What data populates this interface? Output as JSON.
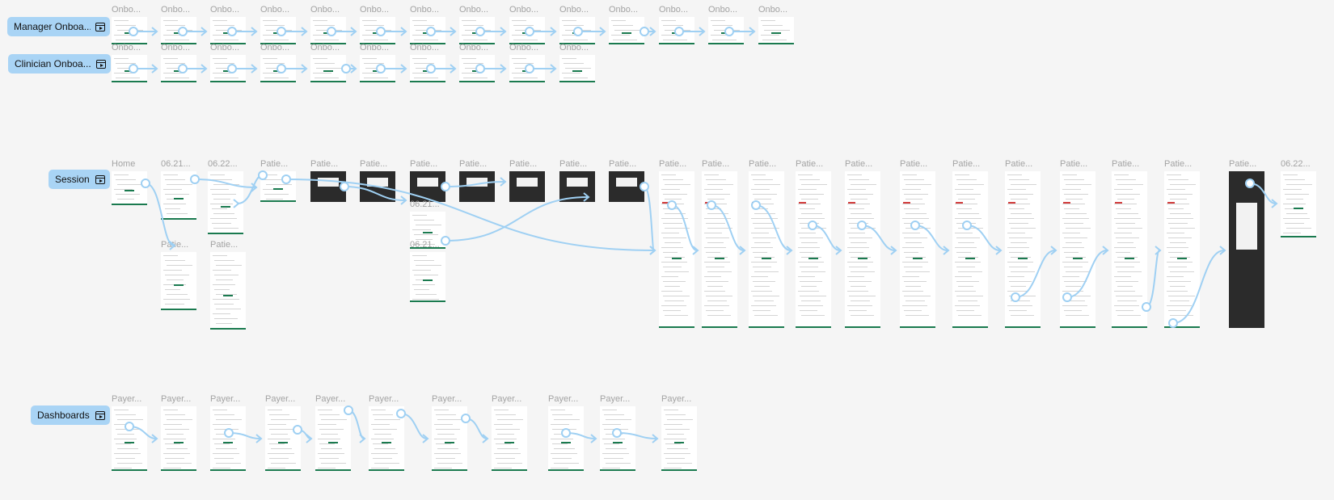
{
  "colors": {
    "canvas": "#f5f5f5",
    "pill": "#a9d4f5",
    "connector": "#9fd0f3",
    "accent": "#1a7a4f",
    "alert": "#d23c3c",
    "frame_title": "#a3a3a3"
  },
  "flows": [
    {
      "id": "manager",
      "label": "Manager Onboa...",
      "icon": "play-frame-icon"
    },
    {
      "id": "clinician",
      "label": "Clinician Onboa...",
      "icon": "play-frame-icon"
    },
    {
      "id": "session",
      "label": "Session",
      "icon": "play-frame-icon"
    },
    {
      "id": "dashboards",
      "label": "Dashboards",
      "icon": "play-frame-icon"
    }
  ],
  "frame_titles": {
    "onbo": "Onbo...",
    "home": "Home",
    "d0621": "06.21...",
    "d0622": "06.22...",
    "patie": "Patie...",
    "payer": "Payer..."
  },
  "frames": [
    {
      "title": "onbo"
    },
    {
      "title": "onbo"
    },
    {
      "title": "onbo"
    },
    {
      "title": "onbo"
    },
    {
      "title": "onbo"
    },
    {
      "title": "onbo"
    },
    {
      "title": "onbo"
    },
    {
      "title": "onbo"
    },
    {
      "title": "onbo"
    },
    {
      "title": "onbo"
    },
    {
      "title": "onbo"
    },
    {
      "title": "onbo"
    },
    {
      "title": "onbo"
    },
    {
      "title": "onbo"
    },
    {
      "title": "onbo"
    },
    {
      "title": "onbo"
    },
    {
      "title": "onbo"
    },
    {
      "title": "onbo"
    },
    {
      "title": "onbo"
    },
    {
      "title": "onbo"
    },
    {
      "title": "onbo"
    },
    {
      "title": "onbo"
    },
    {
      "title": "onbo"
    },
    {
      "title": "onbo"
    },
    {
      "title": "home"
    },
    {
      "title": "d0621"
    },
    {
      "title": "d0622"
    },
    {
      "title": "patie"
    },
    {
      "title": "patie"
    },
    {
      "title": "patie"
    },
    {
      "title": "patie"
    },
    {
      "title": "patie"
    },
    {
      "title": "patie"
    },
    {
      "title": "patie"
    },
    {
      "title": "patie"
    },
    {
      "title": "patie"
    },
    {
      "title": "patie"
    },
    {
      "title": "patie"
    },
    {
      "title": "patie"
    },
    {
      "title": "patie"
    },
    {
      "title": "patie"
    },
    {
      "title": "patie"
    },
    {
      "title": "patie"
    },
    {
      "title": "patie"
    },
    {
      "title": "patie"
    },
    {
      "title": "patie"
    },
    {
      "title": "patie"
    },
    {
      "title": "d0622"
    },
    {
      "title": "patie"
    },
    {
      "title": "patie"
    },
    {
      "title": "d0621"
    },
    {
      "title": "d0621"
    },
    {
      "title": "payer"
    },
    {
      "title": "payer"
    },
    {
      "title": "payer"
    },
    {
      "title": "payer"
    },
    {
      "title": "payer"
    },
    {
      "title": "payer"
    },
    {
      "title": "payer"
    },
    {
      "title": "payer"
    },
    {
      "title": "payer"
    },
    {
      "title": "payer"
    },
    {
      "title": "payer"
    }
  ]
}
